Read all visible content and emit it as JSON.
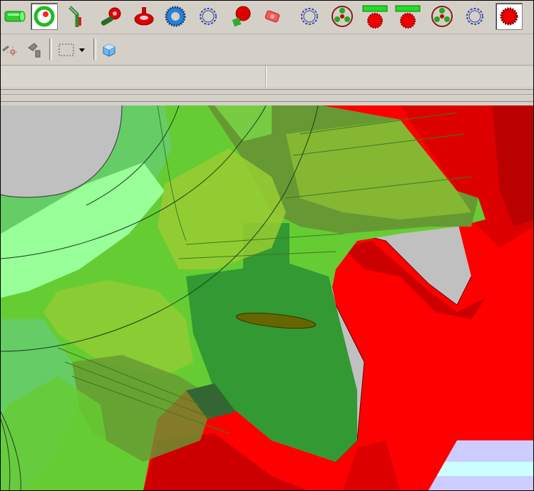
{
  "window": {
    "title": ""
  },
  "toolbar_top": {
    "buttons": [
      {
        "name": "cylinder-tool",
        "icon": "green-cylinder-icon"
      },
      {
        "name": "ring-tool",
        "icon": "green-ring-icon",
        "pressed": true
      },
      {
        "name": "shaft-tool",
        "icon": "bent-shaft-icon"
      },
      {
        "name": "worm-tool",
        "icon": "red-worm-icon"
      },
      {
        "name": "red-ring-tool",
        "icon": "red-ring-icon"
      },
      {
        "name": "blue-gear-tool",
        "icon": "blue-gear-icon"
      },
      {
        "name": "outline-gear-tool",
        "icon": "outline-gear-icon"
      },
      {
        "name": "red-green-gear-tool",
        "icon": "red-green-gear-icon"
      },
      {
        "name": "pink-gear-tool",
        "icon": "pink-gear-icon"
      },
      {
        "name": "outline-gear-tool-2",
        "icon": "outline-gear-icon"
      },
      {
        "name": "planetary-gear-tool",
        "icon": "planetary-gear-icon"
      },
      {
        "name": "rack-gear-tool",
        "icon": "rack-gear-icon"
      },
      {
        "name": "rack-gear-tool-2",
        "icon": "rack-gear-icon"
      },
      {
        "name": "planetary-gear-tool-2",
        "icon": "planetary-gear-icon"
      },
      {
        "name": "outline-gear-tool-3",
        "icon": "outline-gear-icon"
      },
      {
        "name": "red-gear-tool",
        "icon": "red-gear-icon",
        "pressed": true
      }
    ]
  },
  "toolbar_second": {
    "buttons": [
      {
        "name": "snap-tool",
        "icon": "snap-crosshair-icon"
      },
      {
        "name": "magnet-tool",
        "icon": "magnet-icon"
      },
      {
        "name": "select-box-tool",
        "icon": "dashed-select-box-icon"
      },
      {
        "name": "select-dropdown",
        "icon": "dropdown-arrow-icon"
      },
      {
        "name": "3d-view-tool",
        "icon": "cube-icon"
      }
    ]
  },
  "viewport": {
    "scene": "3d-gear-mesh",
    "colors": {
      "red_gear": "#ff0000",
      "green_gear": "#66cc33",
      "dark_green": "#339933",
      "light_green": "#99ff99",
      "background": "#c0c0c0"
    }
  }
}
